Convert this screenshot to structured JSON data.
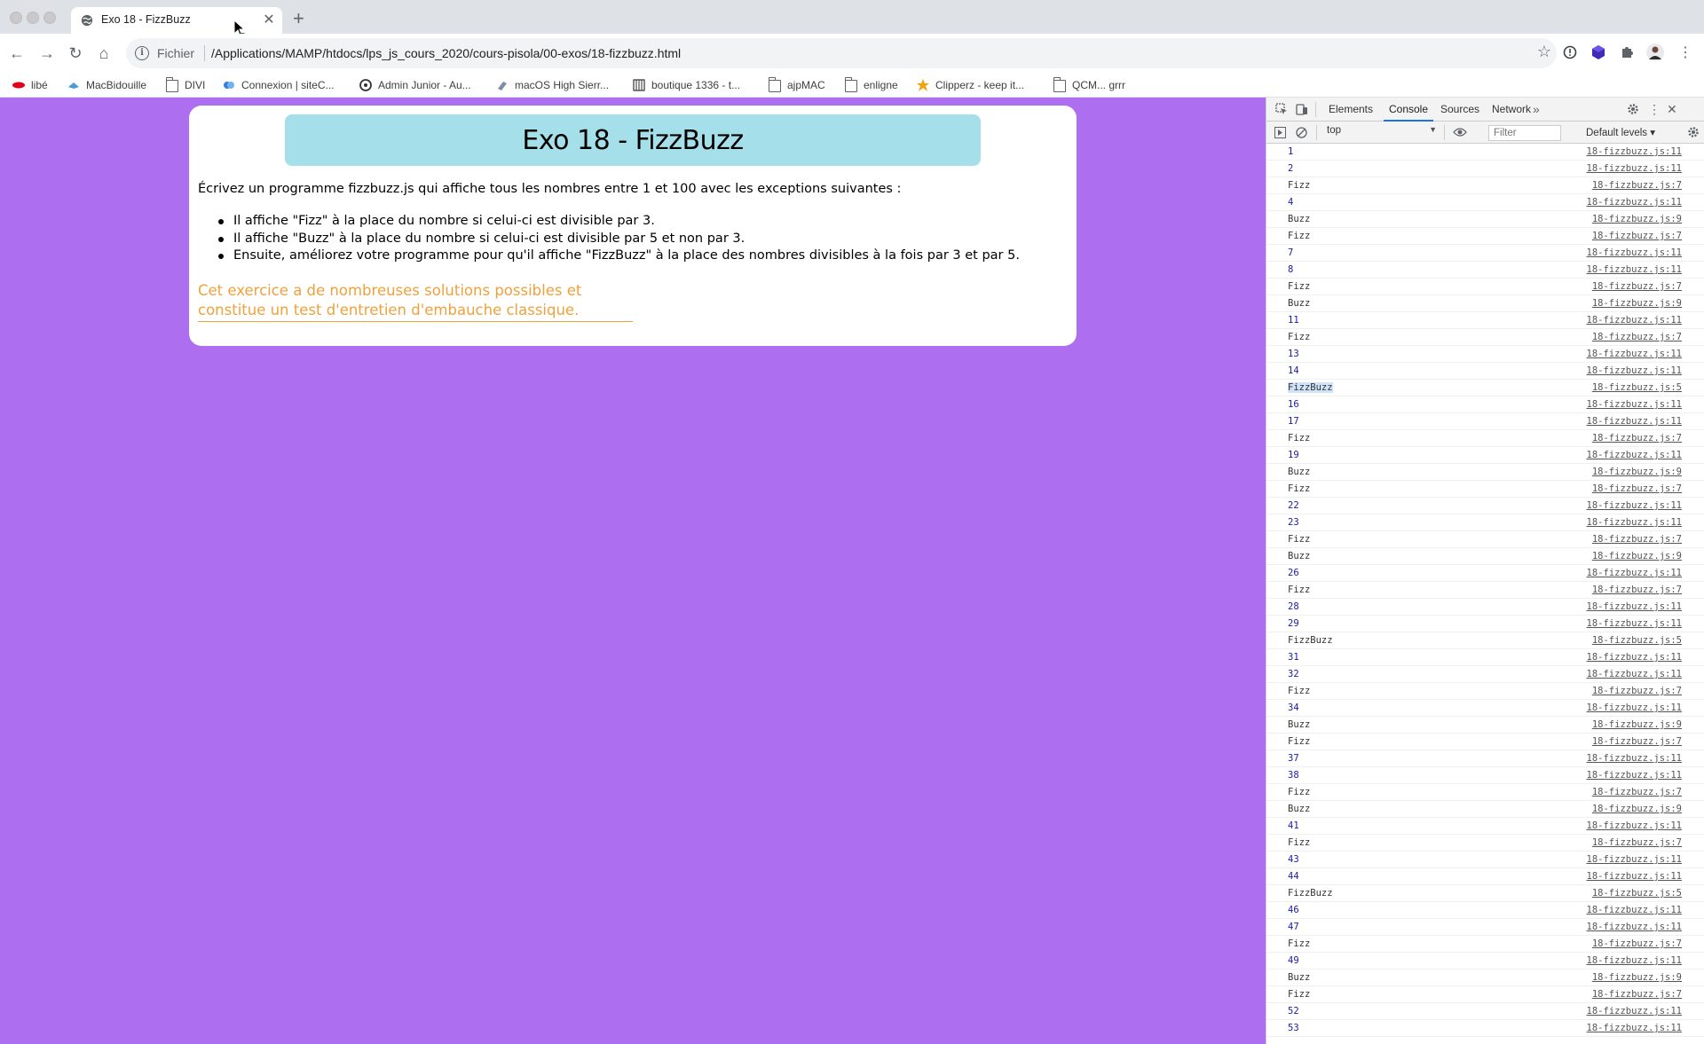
{
  "browser": {
    "tab": {
      "title": "Exo 18 - FizzBuzz"
    },
    "omnibox": {
      "scheme_label": "Fichier",
      "url": "/Applications/MAMP/htdocs/lps_js_cours_2020/cours-pisola/00-exos/18-fizzbuzz.html"
    },
    "bookmarks": [
      {
        "label": "libé",
        "icon": "libe-icon"
      },
      {
        "label": "MacBidouille",
        "icon": "macbidouille-icon"
      },
      {
        "label": "DIVI",
        "icon": "folder-icon"
      },
      {
        "label": "Connexion | siteC...",
        "icon": "sitec-icon"
      },
      {
        "label": "Admin Junior - Au...",
        "icon": "admin-icon"
      },
      {
        "label": "macOS High Sierr...",
        "icon": "macos-icon"
      },
      {
        "label": "boutique 1336 - t...",
        "icon": "boutique-icon"
      },
      {
        "label": "ajpMAC",
        "icon": "folder-icon"
      },
      {
        "label": "enligne",
        "icon": "folder-icon"
      },
      {
        "label": "Clipperz - keep it...",
        "icon": "clipperz-icon"
      },
      {
        "label": "QCM... grrr",
        "icon": "folder-icon"
      }
    ]
  },
  "page": {
    "background_color": "#ad6ff0",
    "title": "Exo 18 - FizzBuzz",
    "intro": "Écrivez un programme fizzbuzz.js qui affiche tous les nombres entre 1 et 100 avec les exceptions suivantes :",
    "rules": [
      "Il affiche \"Fizz\" à la place du nombre si celui-ci est divisible par 3.",
      "Il affiche \"Buzz\" à la place du nombre si celui-ci est divisible par 5 et non par 3.",
      "Ensuite, améliorez votre programme pour qu'il affiche \"FizzBuzz\" à la place des nombres divisibles à la fois par 3 et par 5."
    ],
    "note_line1": "Cet exercice a de nombreuses solutions possibles et",
    "note_line2": "constitue un test d'entretien d'embauche classique."
  },
  "devtools": {
    "tabs": [
      "Elements",
      "Console",
      "Sources",
      "Network"
    ],
    "active_tab": "Console",
    "context": "top",
    "filter_placeholder": "Filter",
    "levels": "Default levels",
    "console": [
      {
        "msg": "1",
        "src": "18-fizzbuzz.js:11"
      },
      {
        "msg": "2",
        "src": "18-fizzbuzz.js:11"
      },
      {
        "msg": "Fizz",
        "src": "18-fizzbuzz.js:7"
      },
      {
        "msg": "4",
        "src": "18-fizzbuzz.js:11"
      },
      {
        "msg": "Buzz",
        "src": "18-fizzbuzz.js:9"
      },
      {
        "msg": "Fizz",
        "src": "18-fizzbuzz.js:7"
      },
      {
        "msg": "7",
        "src": "18-fizzbuzz.js:11"
      },
      {
        "msg": "8",
        "src": "18-fizzbuzz.js:11"
      },
      {
        "msg": "Fizz",
        "src": "18-fizzbuzz.js:7"
      },
      {
        "msg": "Buzz",
        "src": "18-fizzbuzz.js:9"
      },
      {
        "msg": "11",
        "src": "18-fizzbuzz.js:11"
      },
      {
        "msg": "Fizz",
        "src": "18-fizzbuzz.js:7"
      },
      {
        "msg": "13",
        "src": "18-fizzbuzz.js:11"
      },
      {
        "msg": "14",
        "src": "18-fizzbuzz.js:11"
      },
      {
        "msg": "FizzBuzz",
        "src": "18-fizzbuzz.js:5",
        "selected": true
      },
      {
        "msg": "16",
        "src": "18-fizzbuzz.js:11"
      },
      {
        "msg": "17",
        "src": "18-fizzbuzz.js:11"
      },
      {
        "msg": "Fizz",
        "src": "18-fizzbuzz.js:7"
      },
      {
        "msg": "19",
        "src": "18-fizzbuzz.js:11"
      },
      {
        "msg": "Buzz",
        "src": "18-fizzbuzz.js:9"
      },
      {
        "msg": "Fizz",
        "src": "18-fizzbuzz.js:7"
      },
      {
        "msg": "22",
        "src": "18-fizzbuzz.js:11"
      },
      {
        "msg": "23",
        "src": "18-fizzbuzz.js:11"
      },
      {
        "msg": "Fizz",
        "src": "18-fizzbuzz.js:7"
      },
      {
        "msg": "Buzz",
        "src": "18-fizzbuzz.js:9"
      },
      {
        "msg": "26",
        "src": "18-fizzbuzz.js:11"
      },
      {
        "msg": "Fizz",
        "src": "18-fizzbuzz.js:7"
      },
      {
        "msg": "28",
        "src": "18-fizzbuzz.js:11"
      },
      {
        "msg": "29",
        "src": "18-fizzbuzz.js:11"
      },
      {
        "msg": "FizzBuzz",
        "src": "18-fizzbuzz.js:5"
      },
      {
        "msg": "31",
        "src": "18-fizzbuzz.js:11"
      },
      {
        "msg": "32",
        "src": "18-fizzbuzz.js:11"
      },
      {
        "msg": "Fizz",
        "src": "18-fizzbuzz.js:7"
      },
      {
        "msg": "34",
        "src": "18-fizzbuzz.js:11"
      },
      {
        "msg": "Buzz",
        "src": "18-fizzbuzz.js:9"
      },
      {
        "msg": "Fizz",
        "src": "18-fizzbuzz.js:7"
      },
      {
        "msg": "37",
        "src": "18-fizzbuzz.js:11"
      },
      {
        "msg": "38",
        "src": "18-fizzbuzz.js:11"
      },
      {
        "msg": "Fizz",
        "src": "18-fizzbuzz.js:7"
      },
      {
        "msg": "Buzz",
        "src": "18-fizzbuzz.js:9"
      },
      {
        "msg": "41",
        "src": "18-fizzbuzz.js:11"
      },
      {
        "msg": "Fizz",
        "src": "18-fizzbuzz.js:7"
      },
      {
        "msg": "43",
        "src": "18-fizzbuzz.js:11"
      },
      {
        "msg": "44",
        "src": "18-fizzbuzz.js:11"
      },
      {
        "msg": "FizzBuzz",
        "src": "18-fizzbuzz.js:5"
      },
      {
        "msg": "46",
        "src": "18-fizzbuzz.js:11"
      },
      {
        "msg": "47",
        "src": "18-fizzbuzz.js:11"
      },
      {
        "msg": "Fizz",
        "src": "18-fizzbuzz.js:7"
      },
      {
        "msg": "49",
        "src": "18-fizzbuzz.js:11"
      },
      {
        "msg": "Buzz",
        "src": "18-fizzbuzz.js:9"
      },
      {
        "msg": "Fizz",
        "src": "18-fizzbuzz.js:7"
      },
      {
        "msg": "52",
        "src": "18-fizzbuzz.js:11"
      },
      {
        "msg": "53",
        "src": "18-fizzbuzz.js:11"
      }
    ]
  }
}
